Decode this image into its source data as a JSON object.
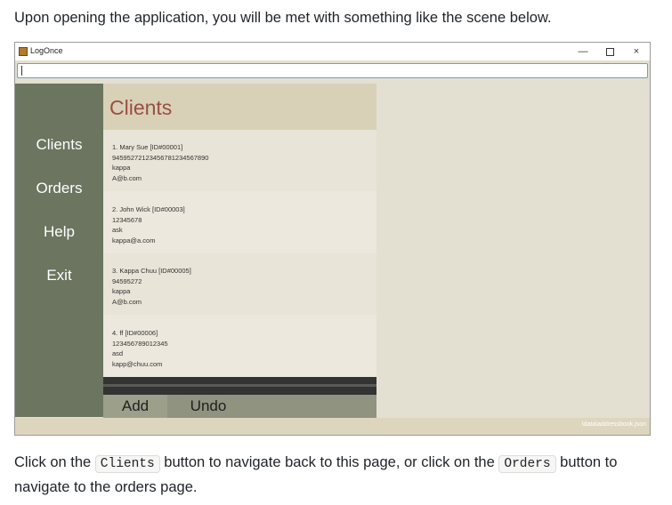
{
  "intro_text": "Upon opening the application, you will be met with something like the scene below.",
  "window": {
    "title": "LogOnce",
    "controls": {
      "minimize": "—",
      "close": "×"
    },
    "command_value": "",
    "sidebar": [
      {
        "label": "Clients"
      },
      {
        "label": "Orders"
      },
      {
        "label": "Help"
      },
      {
        "label": "Exit"
      }
    ],
    "list_title": "Clients",
    "clients": [
      {
        "header": "1.  Mary Sue [ID#00001]",
        "phone": "945952721234567812345678​90",
        "note": "kappa",
        "email": "A@b.com"
      },
      {
        "header": "2.  John Wick [ID#00003]",
        "phone": "12345678",
        "note": "ask",
        "email": "kappa@a.com"
      },
      {
        "header": "3.  Kappa Chuu [ID#00005]",
        "phone": "94595272",
        "note": "kappa",
        "email": "A@b.com"
      },
      {
        "header": "4.  ff [ID#00006]",
        "phone": "123456789012345",
        "note": "asd",
        "email": "kapp@chuu.com"
      }
    ],
    "buttons": {
      "add": "Add",
      "undo": "Undo"
    },
    "status_path": ".\\data\\addressbook.json"
  },
  "outro": {
    "t1": "Click on the ",
    "code1": "Clients",
    "t2": " button to navigate back to this page, or click on the ",
    "code2": "Orders",
    "t3": " button to navigate to the orders page."
  }
}
